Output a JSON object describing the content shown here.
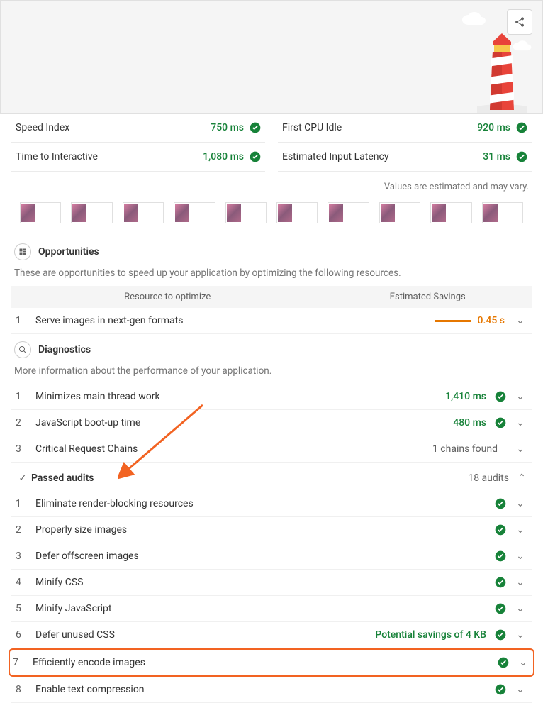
{
  "metrics": {
    "left": [
      {
        "label": "Speed Index",
        "value": "750 ms"
      },
      {
        "label": "Time to Interactive",
        "value": "1,080 ms"
      }
    ],
    "right": [
      {
        "label": "First CPU Idle",
        "value": "920 ms"
      },
      {
        "label": "Estimated Input Latency",
        "value": "31 ms"
      }
    ]
  },
  "estimated_note": "Values are estimated and may vary.",
  "opportunities": {
    "title": "Opportunities",
    "desc": "These are opportunities to speed up your application by optimizing the following resources.",
    "col1": "Resource to optimize",
    "col2": "Estimated Savings",
    "rows": [
      {
        "num": "1",
        "title": "Serve images in next-gen formats",
        "value": "0.45 s"
      }
    ]
  },
  "diagnostics": {
    "title": "Diagnostics",
    "desc": "More information about the performance of your application.",
    "rows": [
      {
        "num": "1",
        "title": "Minimizes main thread work",
        "value": "1,410 ms",
        "pass": true
      },
      {
        "num": "2",
        "title": "JavaScript boot-up time",
        "value": "480 ms",
        "pass": true
      },
      {
        "num": "3",
        "title": "Critical Request Chains",
        "value": "1 chains found",
        "pass": false
      }
    ]
  },
  "passed": {
    "title": "Passed audits",
    "count": "18 audits",
    "rows": [
      {
        "num": "1",
        "title": "Eliminate render-blocking resources",
        "value": ""
      },
      {
        "num": "2",
        "title": "Properly size images",
        "value": ""
      },
      {
        "num": "3",
        "title": "Defer offscreen images",
        "value": ""
      },
      {
        "num": "4",
        "title": "Minify CSS",
        "value": ""
      },
      {
        "num": "5",
        "title": "Minify JavaScript",
        "value": ""
      },
      {
        "num": "6",
        "title": "Defer unused CSS",
        "value": "Potential savings of 4 KB"
      },
      {
        "num": "7",
        "title": "Efficiently encode images",
        "value": "",
        "highlight": true
      },
      {
        "num": "8",
        "title": "Enable text compression",
        "value": ""
      }
    ]
  }
}
